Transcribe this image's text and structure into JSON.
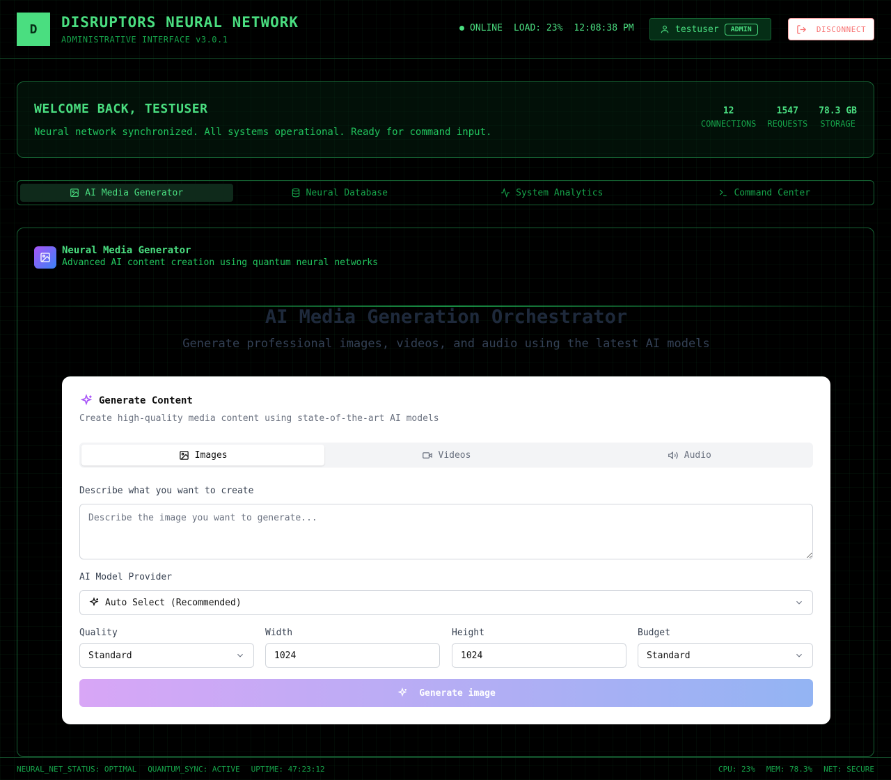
{
  "header": {
    "logo_letter": "D",
    "title": "DISRUPTORS NEURAL NETWORK",
    "subtitle": "ADMINISTRATIVE INTERFACE v3.0.1",
    "status": "ONLINE",
    "load": "LOAD: 23%",
    "time": "12:08:38 PM",
    "username": "testuser",
    "role_badge": "ADMIN",
    "disconnect_label": "DISCONNECT"
  },
  "welcome": {
    "title": "WELCOME BACK, TESTUSER",
    "message": "Neural network synchronized. All systems operational. Ready for command input.",
    "stats": [
      {
        "value": "12",
        "label": "CONNECTIONS"
      },
      {
        "value": "1547",
        "label": "REQUESTS"
      },
      {
        "value": "78.3 GB",
        "label": "STORAGE"
      }
    ]
  },
  "main_tabs": [
    {
      "label": "AI Media Generator",
      "icon": "image-icon",
      "active": true
    },
    {
      "label": "Neural Database",
      "icon": "database-icon",
      "active": false
    },
    {
      "label": "System Analytics",
      "icon": "activity-icon",
      "active": false
    },
    {
      "label": "Command Center",
      "icon": "terminal-icon",
      "active": false
    }
  ],
  "panel": {
    "title": "Neural Media Generator",
    "subtitle": "Advanced AI content creation using quantum neural networks",
    "orchestrator_title": "AI Media Generation Orchestrator",
    "orchestrator_subtitle": "Generate professional images, videos, and audio using the latest AI models"
  },
  "card": {
    "title": "Generate Content",
    "subtitle": "Create high-quality media content using state-of-the-art AI models",
    "media_tabs": [
      {
        "label": "Images",
        "icon": "image-icon",
        "active": true
      },
      {
        "label": "Videos",
        "icon": "video-icon",
        "active": false
      },
      {
        "label": "Audio",
        "icon": "speaker-icon",
        "active": false
      }
    ],
    "prompt_label": "Describe what you want to create",
    "prompt_placeholder": "Describe the image you want to generate...",
    "provider_label": "AI Model Provider",
    "provider_value": "Auto Select (Recommended)",
    "quality_label": "Quality",
    "quality_value": "Standard",
    "width_label": "Width",
    "width_value": "1024",
    "height_label": "Height",
    "height_value": "1024",
    "budget_label": "Budget",
    "budget_value": "Standard",
    "generate_label": "Generate image"
  },
  "footer": {
    "left": [
      "NEURAL_NET_STATUS: OPTIMAL",
      "QUANTUM_SYNC: ACTIVE",
      "UPTIME: 47:23:12"
    ],
    "right": [
      "CPU: 23%",
      "MEM: 78.3%",
      "NET: SECURE"
    ]
  },
  "colors": {
    "accent": "#4ade80",
    "background": "#000000",
    "danger": "#f87171"
  }
}
